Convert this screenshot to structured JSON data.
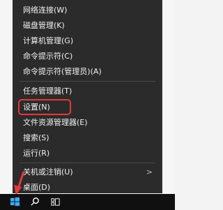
{
  "menu": {
    "items": [
      {
        "label": "网络连接(W)"
      },
      {
        "label": "磁盘管理(K)"
      },
      {
        "label": "计算机管理(G)"
      },
      {
        "label": "命令提示符(C)"
      },
      {
        "label": "命令提示符(管理员)(A)"
      },
      {
        "label": "任务管理器(T)"
      },
      {
        "label": "设置(N)"
      },
      {
        "label": "文件资源管理器(E)"
      },
      {
        "label": "搜索(S)"
      },
      {
        "label": "运行(R)"
      },
      {
        "label": "关机或注销(U)"
      },
      {
        "label": "桌面(D)"
      }
    ],
    "submenu_arrow": ">"
  },
  "taskbar": {
    "icons": [
      "windows-start-icon",
      "search-icon",
      "task-view-icon"
    ]
  },
  "colors": {
    "menu_bg": "#2b2b2b",
    "highlight": "#e53935",
    "taskbar_bg": "#101010"
  }
}
